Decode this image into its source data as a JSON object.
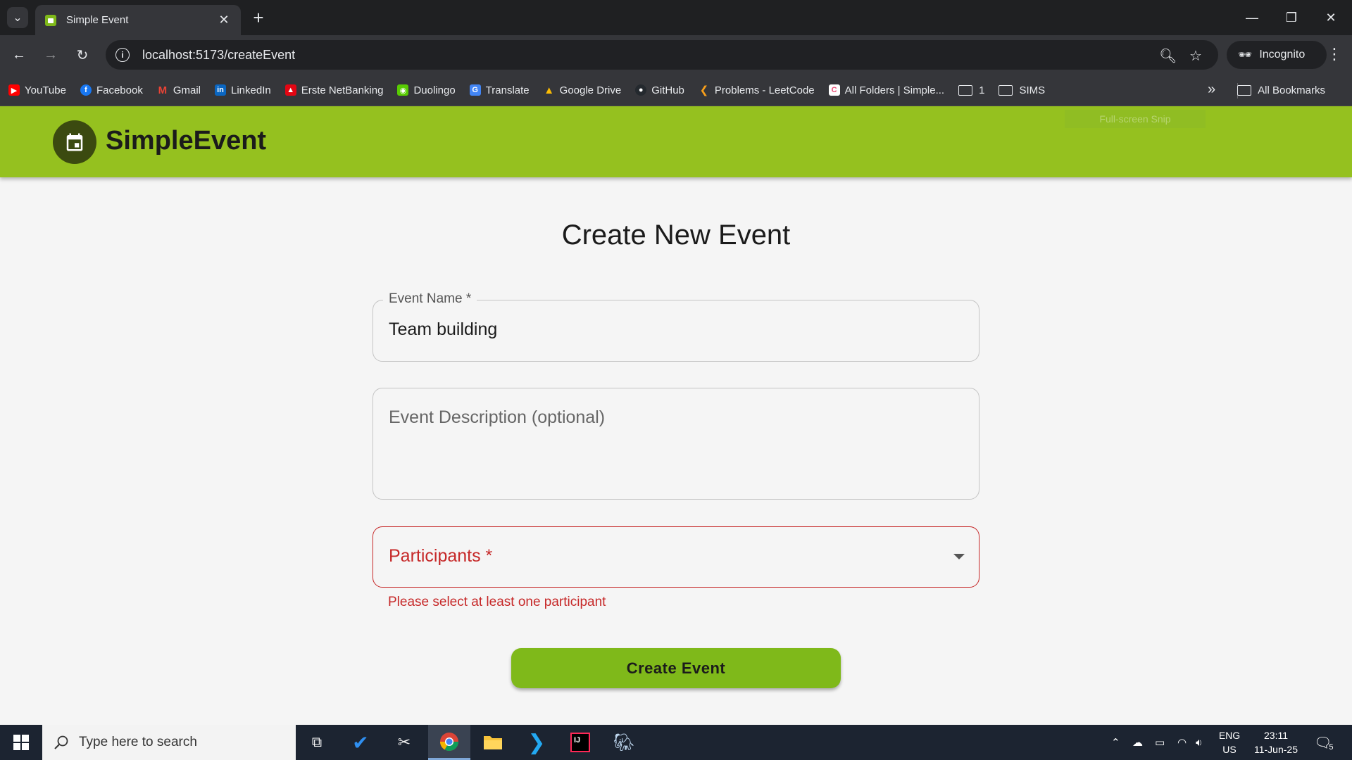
{
  "browser": {
    "tab_title": "Simple Event",
    "url": "localhost:5173/createEvent",
    "incognito_label": "Incognito",
    "bookmarks": [
      {
        "label": "YouTube",
        "color": "#ff0000"
      },
      {
        "label": "Facebook",
        "color": "#1877f2"
      },
      {
        "label": "Gmail",
        "color": "#ea4335"
      },
      {
        "label": "LinkedIn",
        "color": "#0a66c2"
      },
      {
        "label": "Erste NetBanking",
        "color": "#e30613"
      },
      {
        "label": "Duolingo",
        "color": "#58cc02"
      },
      {
        "label": "Translate",
        "color": "#4285f4"
      },
      {
        "label": "Google Drive",
        "color": "#fbbc04"
      },
      {
        "label": "GitHub",
        "color": "#24292e"
      },
      {
        "label": "Problems - LeetCode",
        "color": "#f89f1b"
      },
      {
        "label": "All Folders | Simple...",
        "color": "#e94e77"
      }
    ],
    "folders": [
      "1",
      "SIMS"
    ],
    "all_bookmarks_label": "All Bookmarks"
  },
  "app": {
    "brand": "SimpleEvent",
    "accent_color": "#95c11f",
    "snip_ghost": "Full-screen Snip"
  },
  "form": {
    "title": "Create New Event",
    "event_name_label": "Event Name *",
    "event_name_value": "Team building",
    "description_placeholder": "Event Description (optional)",
    "participants_label": "Participants *",
    "participants_error": "Please select at least one participant",
    "submit_label": "Create Event"
  },
  "taskbar": {
    "search_placeholder": "Type here to search",
    "lang_top": "ENG",
    "lang_bottom": "US",
    "time": "23:11",
    "date": "11-Jun-25",
    "notifications": "5"
  }
}
